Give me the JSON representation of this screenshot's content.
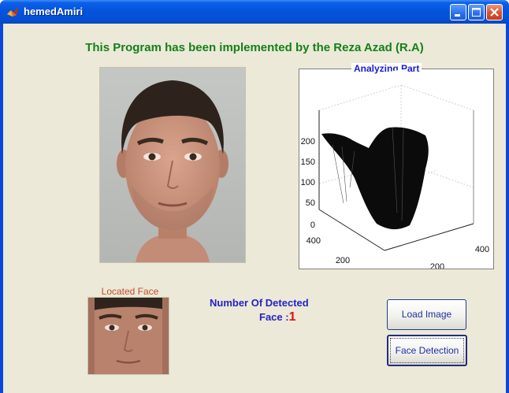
{
  "window": {
    "title": "hemedAmiri",
    "app_icon": "matlab-icon",
    "controls": [
      "minimize-icon",
      "maximize-icon",
      "close-icon"
    ]
  },
  "main": {
    "heading": "This Program has been implemented by the Reza Azad (R.A)",
    "photo_alt": "face-photo",
    "analyzing_panel": {
      "title": "Analyzing Part",
      "plot": {
        "type": "3d-surface",
        "z_ticks": [
          "0",
          "50",
          "100",
          "150",
          "200"
        ],
        "y_ticks": [
          "0",
          "200",
          "400"
        ],
        "x_ticks": [
          "0",
          "200",
          "400"
        ]
      }
    },
    "located_face": {
      "label": "Located Face"
    },
    "detection": {
      "label_line1": "Number Of Detected",
      "label_line2": "Face :",
      "count": "1"
    },
    "buttons": {
      "load": "Load Image",
      "detect": "Face Detection"
    }
  },
  "colors": {
    "heading": "#168018",
    "panel_title": "#1b1bcf",
    "count_label": "#2323c8",
    "count_value": "#e01010",
    "located_label": "#c0502a",
    "client_bg": "#ece9d8"
  }
}
